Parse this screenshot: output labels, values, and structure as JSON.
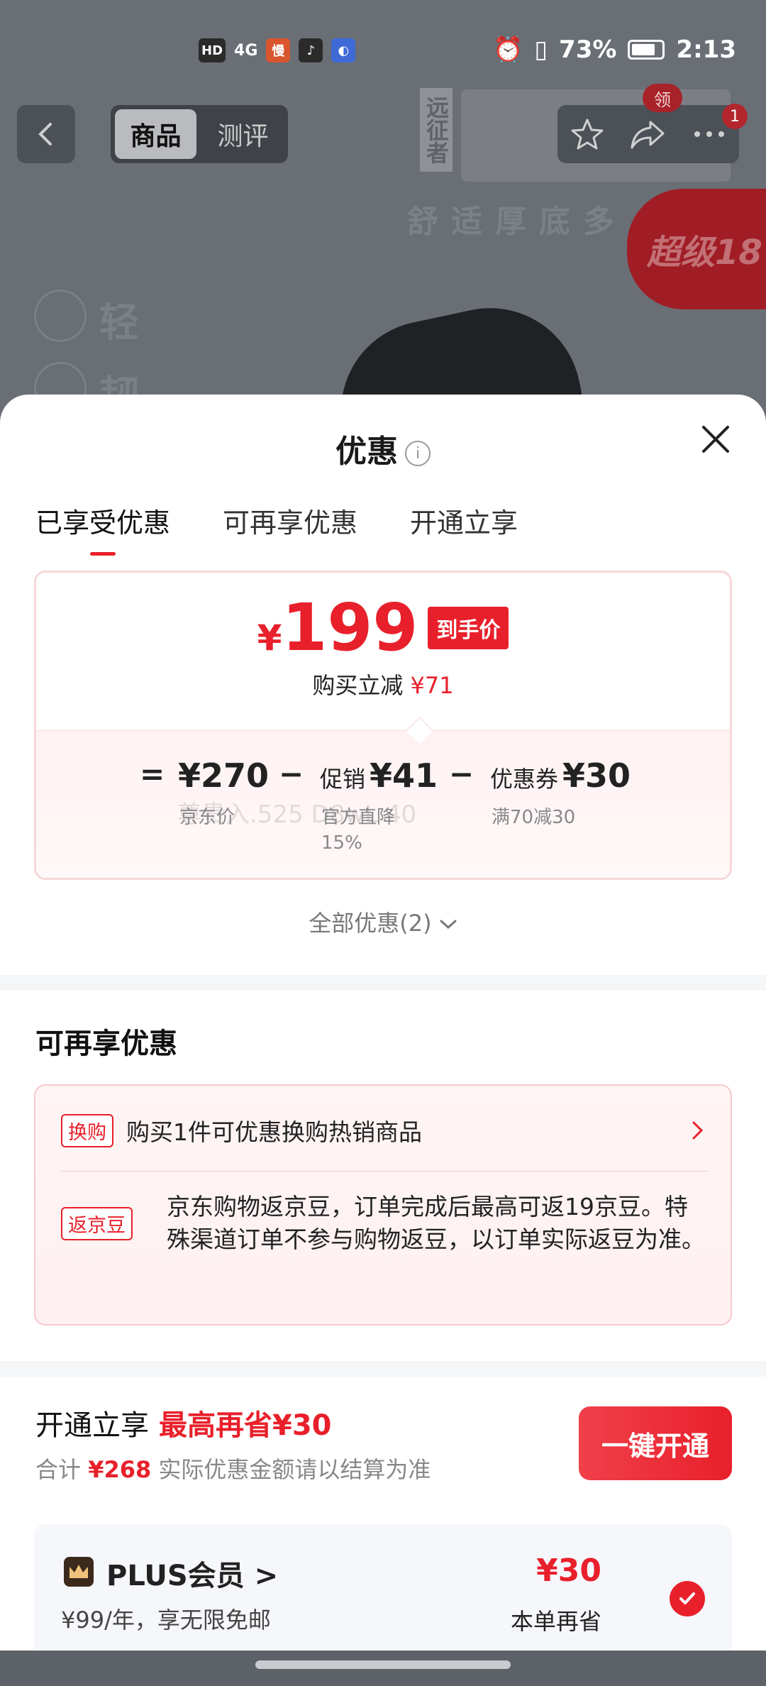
{
  "status_bar": {
    "hd": "HD",
    "network": "4G",
    "battery": "73%",
    "time": "2:13"
  },
  "top_nav": {
    "tab_goods": "商品",
    "tab_review": "测评",
    "coupon_badge": "领",
    "notif_count": "1"
  },
  "hero": {
    "vertical_text": "远征者",
    "subtitle": "舒适厚底多",
    "promo": "超级18",
    "feature1": "轻",
    "feature2": "韧"
  },
  "sheet": {
    "title": "优惠",
    "info_icon": "i",
    "tabs": [
      "已享受优惠",
      "可再享优惠",
      "开通立享"
    ],
    "final_price_currency": "¥",
    "final_price": "199",
    "final_price_tag": "到手价",
    "instant_discount_label": "购买立减",
    "instant_discount_value": "¥71",
    "formula": {
      "eq": "=",
      "jd_price": "¥270",
      "jd_price_label": "京东价",
      "minus1": "−",
      "promo_label": "促销",
      "promo_value": "¥41",
      "promo_detail_1": "官方直降",
      "promo_detail_2": "15%",
      "minus2": "−",
      "coupon_label": "优惠券",
      "coupon_value": "¥30",
      "coupon_detail": "满70减30"
    },
    "all_offers": "全部优惠(2)",
    "extra_section_title": "可再享优惠",
    "extra_items": [
      {
        "tag": "换购",
        "text": "购买1件可优惠换购热销商品"
      },
      {
        "tag": "返京豆",
        "text": "京东购物返京豆，订单完成后最高可返19京豆。特殊渠道订单不参与购物返豆，以订单实际返豆为准。"
      }
    ],
    "open_section": {
      "title": "开通立享",
      "highlight": "最高再省¥30",
      "total_label": "合计",
      "total_value": "¥268",
      "total_note": "实际优惠金额请以结算为准",
      "button": "一键开通"
    },
    "plus": {
      "name": "PLUS会员 >",
      "desc": "¥99/年，享无限免邮",
      "save_value": "¥30",
      "save_label": "本单再省"
    },
    "watermark": "尊贵入.525 D8wL 40"
  },
  "colors": {
    "accent": "#e8202b",
    "overlay": "#5d6168"
  }
}
